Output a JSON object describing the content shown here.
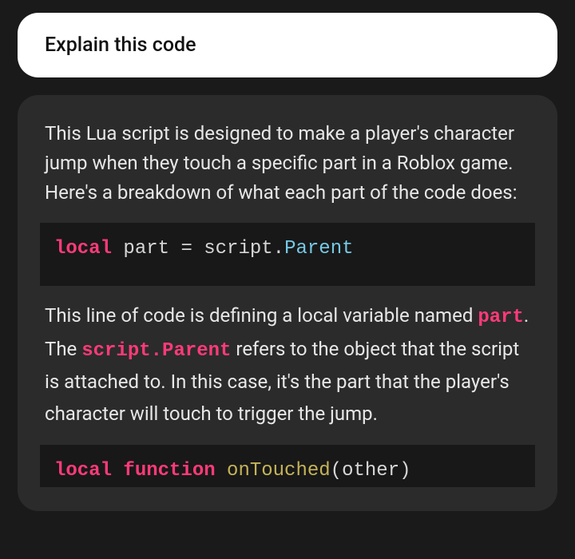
{
  "user_message": {
    "text": "Explain this code"
  },
  "assistant": {
    "intro": "This Lua script is designed to make a player's character jump when they touch a specific part in a Roblox game. Here's a breakdown of what each part of the code does:",
    "code1": {
      "kw_local": "local",
      "ident_part": " part ",
      "op_eq": "= ",
      "ident_script": "script",
      "dot": ".",
      "prop_parent": "Parent"
    },
    "para2_a": "This line of code is defining a local variable named ",
    "inline_part": "part",
    "para2_b": ". The ",
    "inline_scriptparent": "script.Parent",
    "para2_c": " refers to the object that the script is attached to. In this case, it's the part that the player's character will touch to trigger the jump.",
    "code2": {
      "kw_local": "local",
      "sp1": " ",
      "kw_function": "function",
      "sp2": " ",
      "func_name": "onTouched",
      "paren_open": "(",
      "param": "other",
      "paren_close": ")"
    }
  }
}
